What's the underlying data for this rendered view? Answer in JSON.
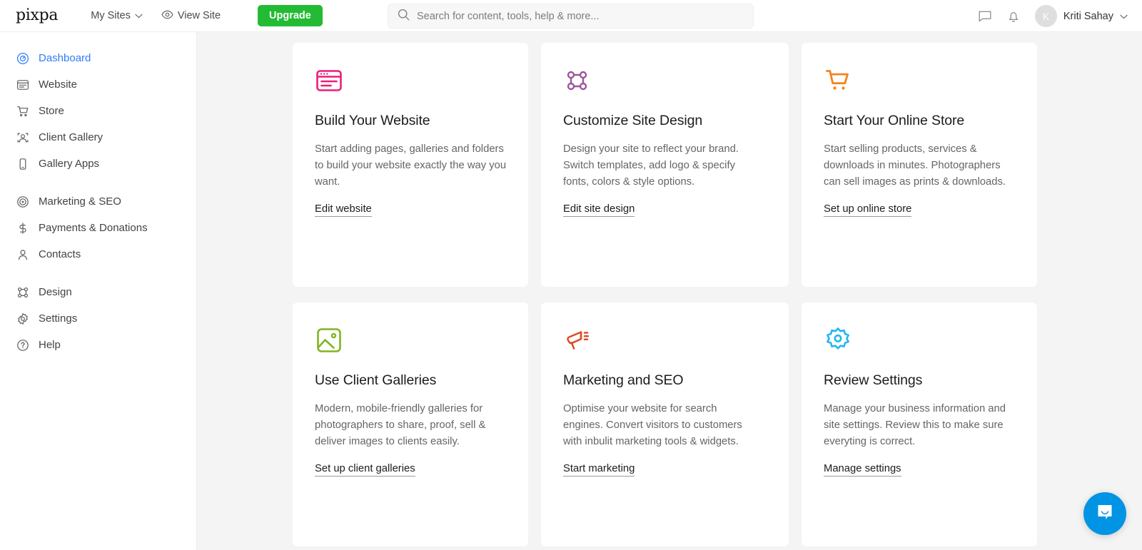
{
  "brand": {
    "logo_text": "pixpa"
  },
  "topnav": {
    "my_sites": "My Sites",
    "view_site": "View Site",
    "upgrade": "Upgrade"
  },
  "search": {
    "placeholder": "Search for content, tools, help & more...",
    "value": ""
  },
  "user": {
    "name": "Kriti Sahay",
    "initial": "K"
  },
  "sidebar": {
    "groups": [
      {
        "items": [
          {
            "label": "Dashboard",
            "icon": "dashboard-icon",
            "active": true
          },
          {
            "label": "Website",
            "icon": "website-icon",
            "active": false
          },
          {
            "label": "Store",
            "icon": "store-cart-icon",
            "active": false
          },
          {
            "label": "Client Gallery",
            "icon": "client-gallery-icon",
            "active": false
          },
          {
            "label": "Gallery Apps",
            "icon": "gallery-apps-icon",
            "active": false
          }
        ]
      },
      {
        "items": [
          {
            "label": "Marketing & SEO",
            "icon": "marketing-seo-icon",
            "active": false
          },
          {
            "label": "Payments & Donations",
            "icon": "payments-dollar-icon",
            "active": false
          },
          {
            "label": "Contacts",
            "icon": "contacts-person-icon",
            "active": false
          }
        ]
      },
      {
        "items": [
          {
            "label": "Design",
            "icon": "design-nodes-icon",
            "active": false
          },
          {
            "label": "Settings",
            "icon": "settings-gear-icon",
            "active": false
          },
          {
            "label": "Help",
            "icon": "help-question-icon",
            "active": false
          }
        ]
      }
    ]
  },
  "cards": [
    {
      "icon": "browser-window-icon",
      "color": "#ec1e79",
      "title": "Build Your Website",
      "desc": "Start adding pages, galleries and folders to build your website exactly the way you want.",
      "link": "Edit website"
    },
    {
      "icon": "design-nodes-icon",
      "color": "#9c5699",
      "title": "Customize Site Design",
      "desc": "Design your site to reflect your brand. Switch templates, add logo & specify fonts, colors & style options.",
      "link": "Edit site design"
    },
    {
      "icon": "shopping-cart-icon",
      "color": "#f7821b",
      "title": "Start Your Online Store",
      "desc": "Start selling products, services & downloads in minutes. Photographers can sell images as prints & downloads.",
      "link": "Set up online store"
    },
    {
      "icon": "image-gallery-icon",
      "color": "#80b522",
      "title": "Use Client Galleries",
      "desc": "Modern, mobile-friendly galleries for photographers to share, proof, sell & deliver images to clients easily.",
      "link": "Set up client galleries"
    },
    {
      "icon": "megaphone-icon",
      "color": "#e04a25",
      "title": "Marketing and SEO",
      "desc": "Optimise your website for search engines. Convert visitors to customers with inbulit marketing tools & widgets.",
      "link": "Start marketing"
    },
    {
      "icon": "settings-gear-icon",
      "color": "#23b6ef",
      "title": "Review Settings",
      "desc": "Manage your business information and site settings. Review this to make sure everyting is correct.",
      "link": "Manage settings"
    }
  ],
  "chat": {
    "icon": "chat-bubble-icon",
    "accent": "#0294e4"
  },
  "colors": {
    "active_nav": "#2f7bfb",
    "upgrade_green": "#22bb33",
    "content_bg": "#f4f4f4"
  }
}
